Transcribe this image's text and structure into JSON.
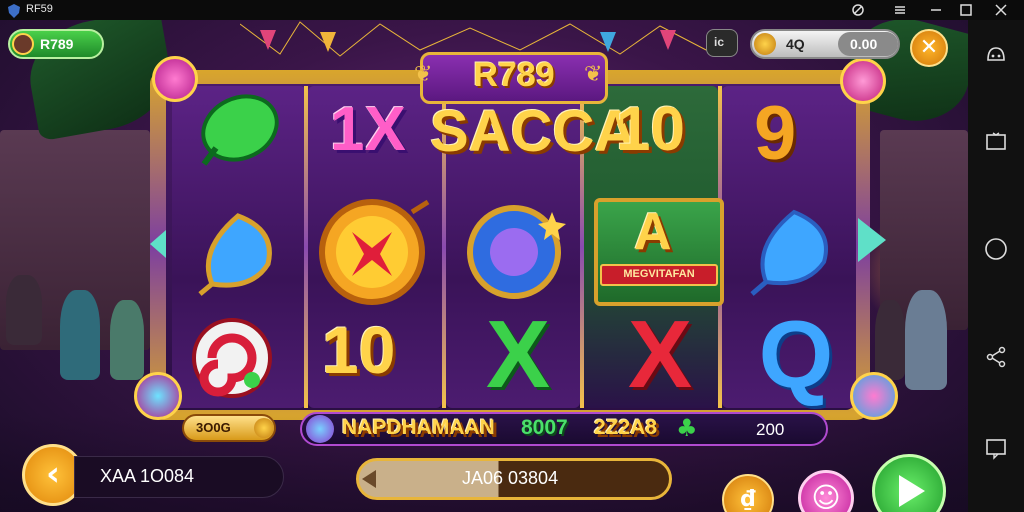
{
  "window": {
    "title": "RF59"
  },
  "game": {
    "logo": "R789",
    "banner": {
      "left": "1X",
      "center": "SACCA",
      "right": "10"
    },
    "reel_symbols": {
      "col1": [
        "green-candy",
        "blue-leaf-gem",
        "swirl-candy"
      ],
      "col2": [
        "orange-coin-x",
        "10"
      ],
      "col3": [
        "blue-orb-gem",
        "X"
      ],
      "col4": [
        "A",
        "X"
      ],
      "col5": [
        "9",
        "blue-leaf-gem",
        "Q"
      ]
    },
    "letters": {
      "col2_bottom": "10",
      "col3_bottom": "X",
      "col4_top": "A",
      "col4_ribbon": "MEGVITAFAN",
      "col4_bottom": "X",
      "col5_top": "9",
      "col5_bottom": "Q"
    }
  },
  "hud": {
    "balance_label": "R789",
    "top_small_label": "ic",
    "top_value_a": "4Q",
    "top_value_b": "0.00"
  },
  "bottom": {
    "bet_chip": "3O0G",
    "ticker_text": "NAPDHAMAAN",
    "ticker_num": "8007",
    "ticker_code": "2Z2A8",
    "ticker_value": "200",
    "left_value": "XAA 1O084",
    "center_value": "JA06 03804"
  },
  "colors": {
    "gold": "#ffd34a",
    "accent_green": "#2fc24a",
    "accent_orange": "#f3a21a",
    "purple": "#5b1880"
  }
}
